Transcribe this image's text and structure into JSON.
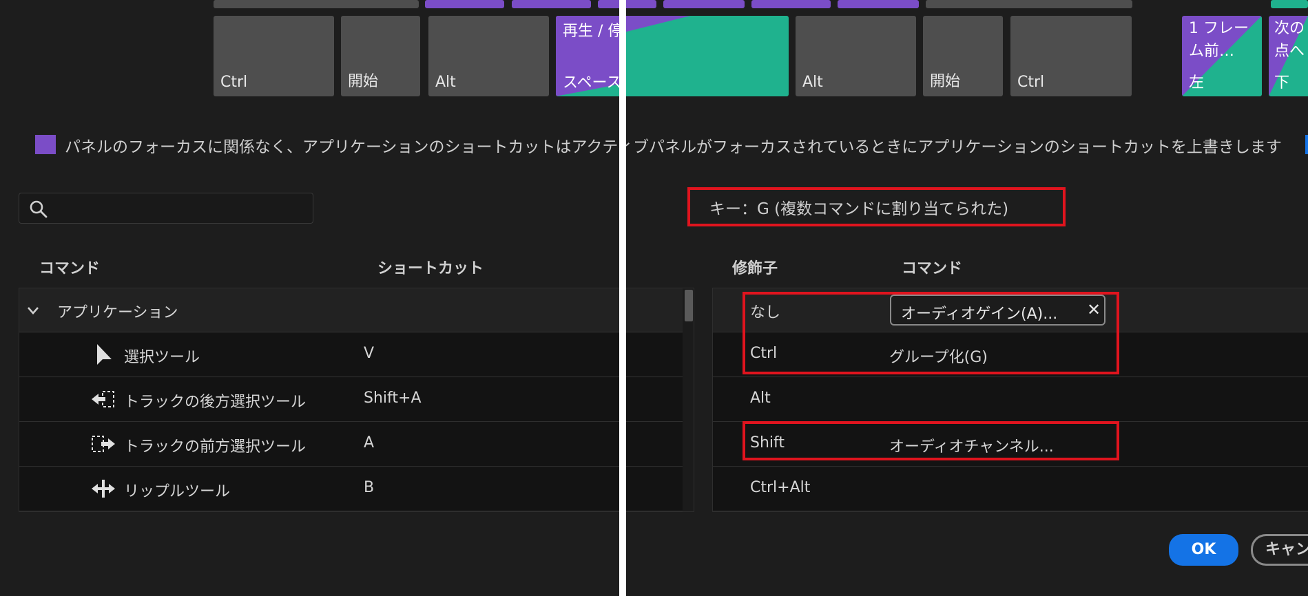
{
  "keyboard": {
    "keys": [
      "Ctrl",
      "開始",
      "Alt",
      "スペース",
      "Alt",
      "開始",
      "Ctrl"
    ],
    "play_pause_label": "再生 / 停",
    "prev_frame": {
      "name": "1 フレーム前…",
      "key": "左"
    },
    "next_edit": {
      "name": "次の点へ",
      "key": "下"
    }
  },
  "focus_notice": "パネルのフォーカスに関係なく、アプリケーションのショートカットはアクティブパネルがフォーカスされているときにアプリケーションのショートカットを上書きします",
  "search": {
    "placeholder": ""
  },
  "key_info": "キー：G (複数コマンドに割り当てられた)",
  "left_table": {
    "col_command": "コマンド",
    "col_shortcut": "ショートカット",
    "group": "アプリケーション",
    "rows": [
      {
        "name": "選択ツール",
        "shortcut": "V",
        "icon": "arrow-cursor-icon"
      },
      {
        "name": "トラックの後方選択ツール",
        "shortcut": "Shift+A",
        "icon": "track-select-backward-icon"
      },
      {
        "name": "トラックの前方選択ツール",
        "shortcut": "A",
        "icon": "track-select-forward-icon"
      },
      {
        "name": "リップルツール",
        "shortcut": "B",
        "icon": "ripple-edit-icon"
      }
    ]
  },
  "right_table": {
    "col_modifier": "修飾子",
    "col_command": "コマンド",
    "rows": [
      {
        "modifier": "なし",
        "command": "オーディオゲイン(A)..."
      },
      {
        "modifier": "Ctrl",
        "command": "グループ化(G)"
      },
      {
        "modifier": "Alt",
        "command": ""
      },
      {
        "modifier": "Shift",
        "command": "オーディオチャンネル..."
      },
      {
        "modifier": "Ctrl+Alt",
        "command": ""
      }
    ]
  },
  "buttons": {
    "ok": "OK",
    "cancel": "キャン"
  },
  "colors": {
    "purple": "#7b4dc7",
    "green": "#1fb28e",
    "ok_blue": "#1473e6",
    "highlight_red": "#e0141e"
  }
}
